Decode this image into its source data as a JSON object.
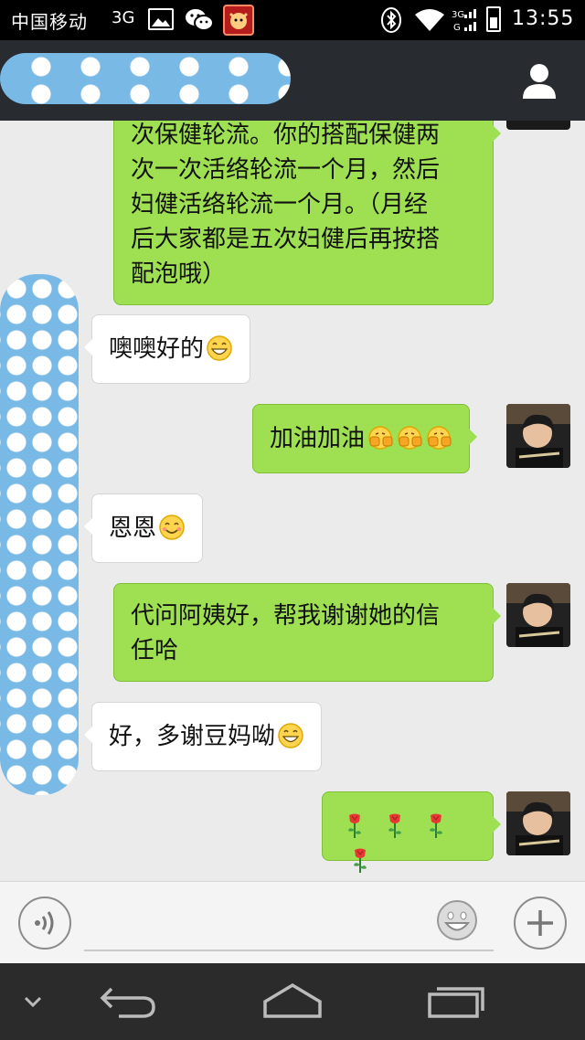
{
  "status_bar": {
    "carrier": "中国移动",
    "network": "3G",
    "time": "13:55",
    "icons": [
      "gallery-icon",
      "wechat-icon",
      "app-icon",
      "bluetooth-icon",
      "wifi-icon",
      "signal-icon",
      "battery-icon"
    ]
  },
  "nav": {
    "profile_icon": "person-icon"
  },
  "messages": [
    {
      "side": "out",
      "lines": [
        "次保健轮流。你的搭配保健两",
        "次一次活络轮流一个月，然后",
        "妇健活络轮流一个月。（月经",
        "后大家都是五次妇健后再按搭",
        "配泡哦）"
      ]
    },
    {
      "side": "in",
      "text": "噢噢好的",
      "emoji": [
        "grin-emoji"
      ]
    },
    {
      "side": "out",
      "text": "加油加油",
      "emoji": [
        "fist-emoji",
        "fist-emoji",
        "fist-emoji"
      ]
    },
    {
      "side": "in",
      "text": "恩恩",
      "emoji": [
        "smile-emoji"
      ]
    },
    {
      "side": "out",
      "lines": [
        "代问阿姨好，帮我谢谢她的信",
        "任哈"
      ]
    },
    {
      "side": "in",
      "text": "好，多谢豆妈呦",
      "emoji": [
        "grin-emoji"
      ]
    },
    {
      "side": "out",
      "text": "",
      "emoji": [
        "rose-emoji",
        "rose-emoji",
        "rose-emoji",
        "rose-emoji"
      ]
    }
  ],
  "input_bar": {
    "voice_icon": "voice-icon",
    "input_value": "",
    "emoji_icon": "emoji-icon",
    "plus_icon": "plus-icon"
  },
  "system_nav": {
    "icons": [
      "chevron-down-icon",
      "back-icon",
      "home-icon",
      "recents-icon"
    ]
  },
  "colors": {
    "status_bg": "#000000",
    "nav_bg": "#282b30",
    "chat_bg": "#ebebeb",
    "out_bubble": "#9ee052",
    "in_bubble": "#ffffff",
    "redaction": "#79b9e6"
  }
}
